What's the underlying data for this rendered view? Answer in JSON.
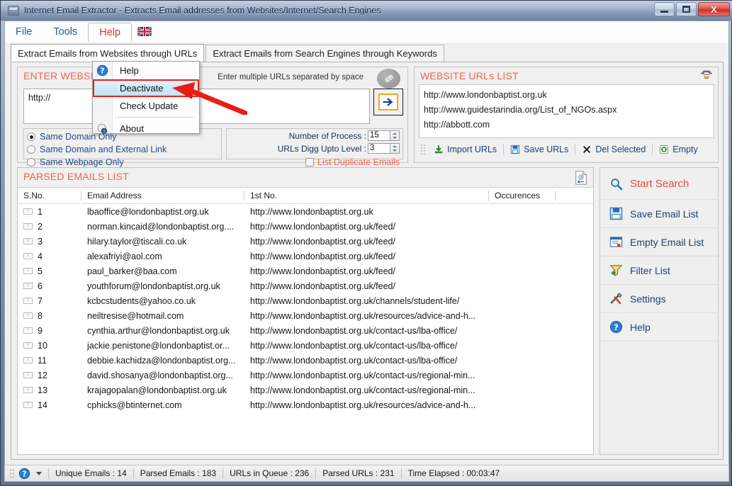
{
  "window": {
    "title": "Internet Email Extractor - Extracts Email addresses from Websites/Internet/Search Engines",
    "app_icon": "app-window-icon",
    "minimize_label": "Minimize",
    "maximize_label": "Maximize",
    "close_label": "X"
  },
  "menubar": {
    "items": [
      {
        "label": "File",
        "active": false
      },
      {
        "label": "Tools",
        "active": false
      },
      {
        "label": "Help",
        "active": true
      }
    ],
    "flag_icon": "union-jack-flag-icon"
  },
  "dropdown": {
    "open_for": "Help",
    "items": [
      {
        "label": "Help",
        "icon": "help-question-icon",
        "selected": false
      },
      {
        "label": "Deactivate",
        "icon": "",
        "selected": true
      },
      {
        "label": "Check Update",
        "icon": "",
        "selected": false
      },
      {
        "label": "About",
        "icon": "about-info-icon",
        "selected": false
      }
    ]
  },
  "tabs": [
    {
      "label": "Extract Emails from Websites through URLs",
      "selected": true
    },
    {
      "label": "Extract Emails from Search Engines through Keywords",
      "selected": false
    }
  ],
  "enter_website": {
    "title": "ENTER WEBSITE",
    "hint": "Enter multiple URLs separated by space",
    "link_icon": "chain-link-icon",
    "url_value": "http://",
    "url_placeholder": "http://",
    "go_icon": "arrow-right-icon",
    "scope_options": [
      {
        "label": "Same Domain Only",
        "selected": true
      },
      {
        "label": "Same Domain and External Link",
        "selected": false
      },
      {
        "label": "Same Webpage Only",
        "selected": false
      }
    ],
    "number_of_process": {
      "label": "Number of Process :",
      "value": "15"
    },
    "urls_digg_level": {
      "label": "URLs Digg Upto Level :",
      "value": "3"
    },
    "list_duplicate": {
      "label": "List Duplicate Emails",
      "checked": false
    }
  },
  "website_urls": {
    "title": "WEBSITE URLs LIST",
    "sheet_icon": "url-sheet-icon",
    "urls": [
      "http://www.londonbaptist.org.uk",
      "http://www.guidestarindia.org/List_of_NGOs.aspx",
      "http://abbott.com"
    ],
    "toolbar": [
      {
        "label": "Import URLs",
        "icon": "import-down-arrow-icon"
      },
      {
        "label": "Save URLs",
        "icon": "save-disk-icon"
      },
      {
        "label": "Del Selected",
        "icon": "delete-x-icon"
      },
      {
        "label": "Empty",
        "icon": "empty-circle-icon"
      }
    ]
  },
  "parsed_emails": {
    "title": "PARSED EMAILS LIST",
    "export_icon": "email-export-icon",
    "columns": [
      "S.No.",
      "Email Address",
      "1st No.",
      "Occurences"
    ],
    "rows": [
      {
        "sno": "1",
        "email": "lbaoffice@londonbaptist.org.uk",
        "url": "http://www.londonbaptist.org.uk",
        "occurences": ""
      },
      {
        "sno": "2",
        "email": "norman.kincaid@londonbaptist.org....",
        "url": "http://www.londonbaptist.org.uk/feed/",
        "occurences": ""
      },
      {
        "sno": "3",
        "email": "hilary.taylor@tiscali.co.uk",
        "url": "http://www.londonbaptist.org.uk/feed/",
        "occurences": ""
      },
      {
        "sno": "4",
        "email": "alexafriyi@aol.com",
        "url": "http://www.londonbaptist.org.uk/feed/",
        "occurences": ""
      },
      {
        "sno": "5",
        "email": "paul_barker@baa.com",
        "url": "http://www.londonbaptist.org.uk/feed/",
        "occurences": ""
      },
      {
        "sno": "6",
        "email": "youthforum@londonbaptist.org.uk",
        "url": "http://www.londonbaptist.org.uk/feed/",
        "occurences": ""
      },
      {
        "sno": "7",
        "email": "kcbcstudents@yahoo.co.uk",
        "url": "http://www.londonbaptist.org.uk/channels/student-life/",
        "occurences": ""
      },
      {
        "sno": "8",
        "email": "neiltresise@hotmail.com",
        "url": "http://www.londonbaptist.org.uk/resources/advice-and-h...",
        "occurences": ""
      },
      {
        "sno": "9",
        "email": "cynthia.arthur@londonbaptist.org.uk",
        "url": "http://www.londonbaptist.org.uk/contact-us/lba-office/",
        "occurences": ""
      },
      {
        "sno": "10",
        "email": "jackie.penistone@londonbaptist.or...",
        "url": "http://www.londonbaptist.org.uk/contact-us/lba-office/",
        "occurences": ""
      },
      {
        "sno": "11",
        "email": "debbie.kachidza@londonbaptist.org...",
        "url": "http://www.londonbaptist.org.uk/contact-us/lba-office/",
        "occurences": ""
      },
      {
        "sno": "12",
        "email": "david.shosanya@londonbaptist.org...",
        "url": "http://www.londonbaptist.org.uk/contact-us/regional-min...",
        "occurences": ""
      },
      {
        "sno": "13",
        "email": "krajagopalan@londonbaptist.org.uk",
        "url": "http://www.londonbaptist.org.uk/contact-us/regional-min...",
        "occurences": ""
      },
      {
        "sno": "14",
        "email": "cphicks@btinternet.com",
        "url": "http://www.londonbaptist.org.uk/resources/advice-and-h...",
        "occurences": ""
      }
    ]
  },
  "actions": [
    {
      "label": "Start Search",
      "icon": "magnifier-search-icon",
      "primary": true
    },
    {
      "label": "Save Email List",
      "icon": "save-disk-icon",
      "primary": false
    },
    {
      "label": "Empty Email List",
      "icon": "empty-list-icon",
      "primary": false
    },
    {
      "label": "Filter List",
      "icon": "funnel-filter-icon",
      "primary": false
    },
    {
      "label": "Settings",
      "icon": "tools-settings-icon",
      "primary": false
    },
    {
      "label": "Help",
      "icon": "help-question-icon",
      "primary": false
    }
  ],
  "statusbar": {
    "help_icon": "help-question-icon",
    "items": [
      "Unique Emails :  14",
      "Parsed Emails :  183",
      "URLs in Queue :  236",
      "Parsed URLs :  231",
      "Time Elapsed :  00:03:47"
    ]
  },
  "colors": {
    "group_title": "#f0654d",
    "accent_blue": "#1f3f6e",
    "primary_action": "#e74c3c",
    "selection": "#bfe4f8",
    "annotation_red": "#e8231c"
  }
}
